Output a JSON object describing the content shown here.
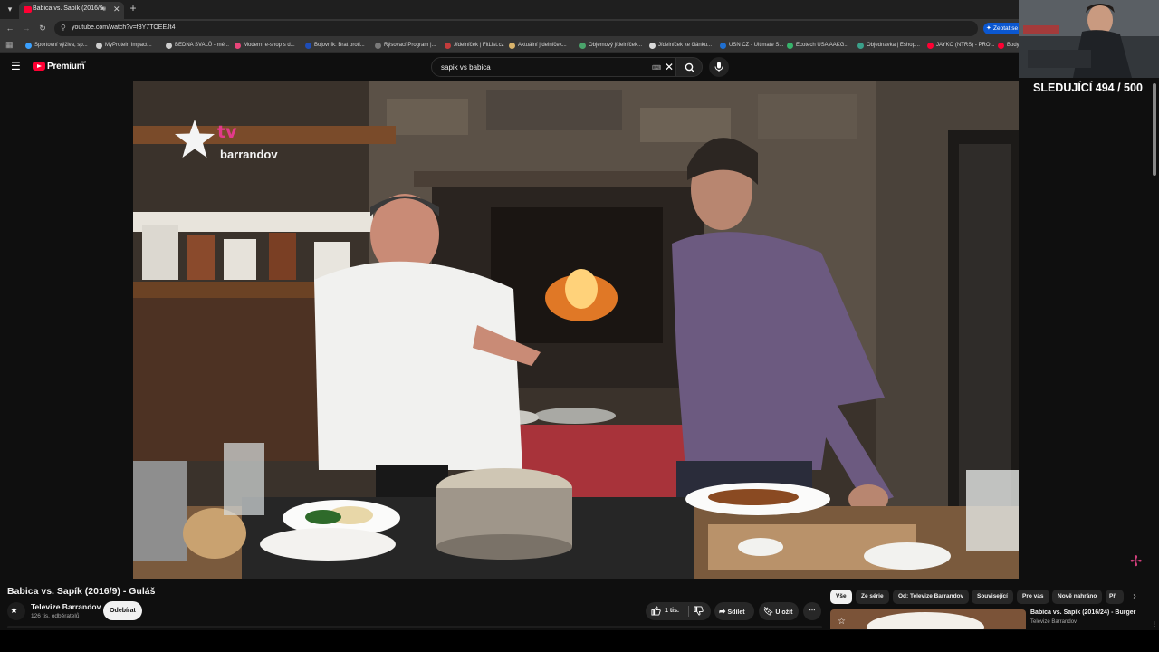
{
  "browser": {
    "tab_title": "Babica vs. Sapík (2016/9) - ",
    "new_tab": "+",
    "url": "youtube.com/watch?v=f3Y7TOEEJt4",
    "ask_button": "Zeptat se",
    "bookmarks": [
      {
        "label": "Sportovní výživa, sp...",
        "color": "#3aa0ff"
      },
      {
        "label": "MyProtein Impact...",
        "color": "#cfcfcf"
      },
      {
        "label": "BEDNA SVALŮ - mé...",
        "color": "#cfcfcf"
      },
      {
        "label": "Moderní e-shop s d...",
        "color": "#e8457a"
      },
      {
        "label": "Bojovník: Brat proti...",
        "color": "#1e4db7"
      },
      {
        "label": "Rýsovací Program |...",
        "color": "#7a7a7a"
      },
      {
        "label": "Jídelníček | FitList.cz",
        "color": "#c43c3c"
      },
      {
        "label": "Aktuální jídelníček...",
        "color": "#d9b36b"
      },
      {
        "label": "Objemový jídelníček...",
        "color": "#4aa36b"
      },
      {
        "label": "Jídelníček ke článku...",
        "color": "#d9d9d9"
      },
      {
        "label": "USN CZ - Ultimate S...",
        "color": "#1f6fd1"
      },
      {
        "label": "Ecotech USA AAKG...",
        "color": "#37b36b"
      },
      {
        "label": "Objednávka | Eshop...",
        "color": "#3aa08a"
      },
      {
        "label": "JAYKO (NTRS) - PRO...",
        "color": "#ff0033"
      },
      {
        "label": "Body",
        "color": "#ff0033"
      }
    ]
  },
  "youtube": {
    "brand": "Premium",
    "country": "CZ",
    "search_query": "sapik vs babica"
  },
  "player": {
    "watermark_tv": "tv",
    "watermark_name": "barrandov"
  },
  "overlay": {
    "sub_counter": "SLEDUJÍCÍ 494 / 500"
  },
  "video": {
    "title": "Babica vs. Sapík (2016/9) - Guláš",
    "channel": "Televize Barrandov",
    "subscribers": "126 tis. odběratelů",
    "unsubscribe_label": "Odebírat",
    "likes": "1 tis.",
    "share_label": "Sdílet",
    "save_label": "Uložit"
  },
  "chips": [
    "Vše",
    "Ze série",
    "Od: Televize Barrandov",
    "Související",
    "Pro vás",
    "Nově nahráno",
    "Př"
  ],
  "recommendation": {
    "title": "Babica vs. Sapík (2016/24) - Burger",
    "channel": "Televize Barrandov"
  },
  "colors": {
    "accent_red": "#ff0033",
    "brand_pink": "#e33a8a",
    "ask_blue": "#0b57d0"
  }
}
